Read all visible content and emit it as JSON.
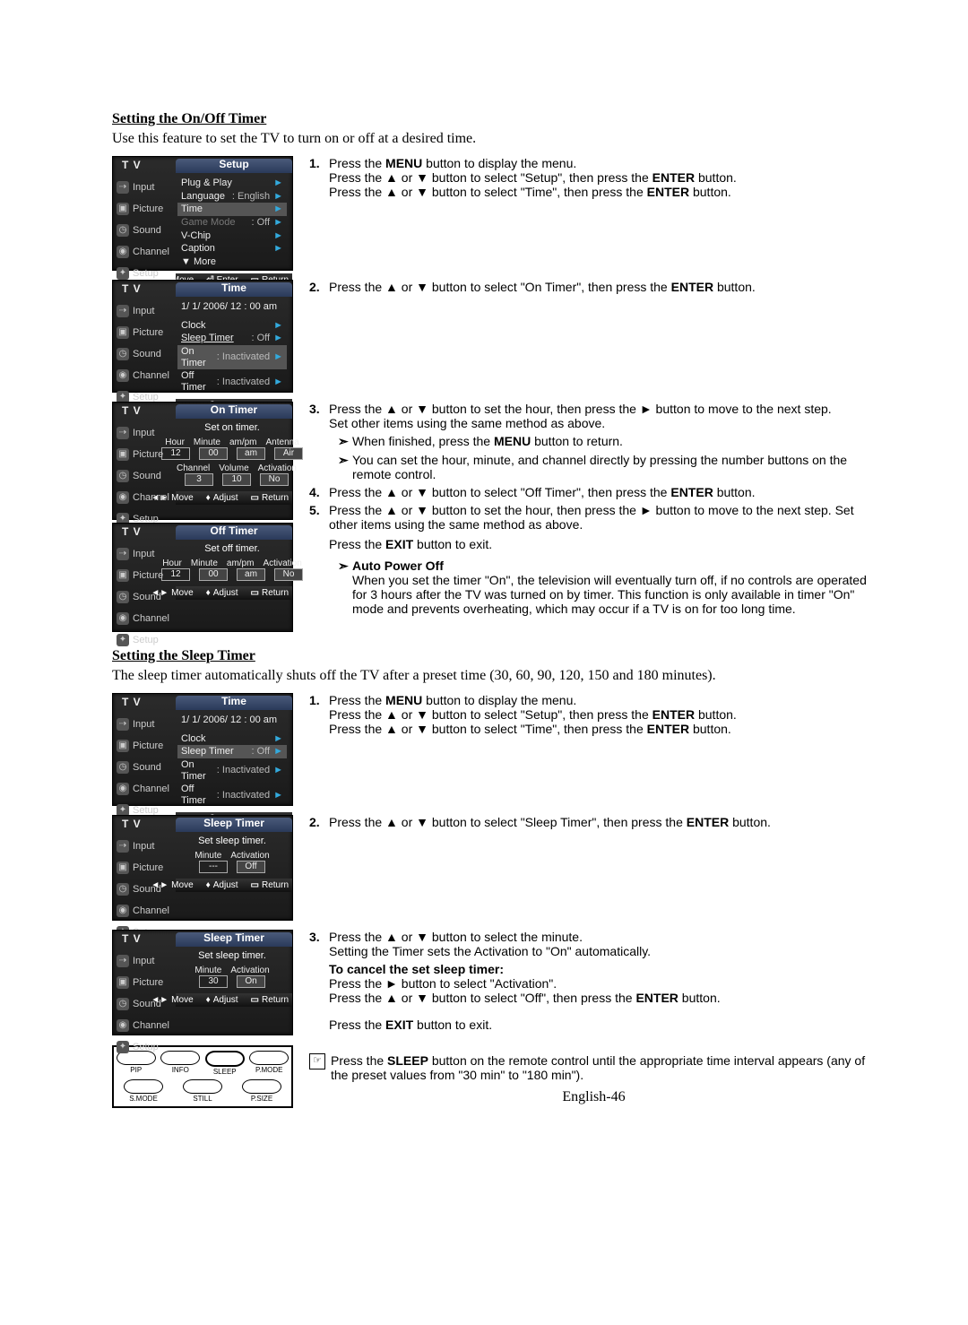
{
  "page": {
    "number": "English-46"
  },
  "section1": {
    "heading": "Setting the On/Off Timer",
    "intro": "Use this feature to set the TV to turn on or off at a desired time.",
    "step1": {
      "l1a": "Press the ",
      "menu": "MENU",
      "l1b": " button to display the menu.",
      "l2a": "Press the ",
      "l2b": " button to select \"Setup\", then press the ",
      "enter": "ENTER",
      "l2c": " button.",
      "l3a": "Press the ",
      "l3b": " button to select \"Time\", then press the ",
      "l3c": " button."
    },
    "step2": {
      "a": "Press the ",
      "b": " button to select \"On Timer\", then press the ",
      "enter": "ENTER",
      "c": " button."
    },
    "step3": {
      "a": "Press the ",
      "b": " button to set the hour, then press the ",
      "c": " button to move to the next step.",
      "d": "Set other items using the same method as above.",
      "sub1a": "When finished, press the ",
      "menu": "MENU",
      "sub1b": " button to return.",
      "sub2": "You can set the hour, minute, and channel directly by pressing the number buttons on the remote control."
    },
    "step4": {
      "a": "Press the ",
      "b": " button to select \"Off Timer\", then press the ",
      "enter": "ENTER",
      "c": " button."
    },
    "step5": {
      "a": "Press the ",
      "b": " button to set the hour, then press the ",
      "c": " button to move to the next step. Set other items using the same method as above.",
      "exit_a": "Press the ",
      "exit": "EXIT",
      "exit_b": " button to exit.",
      "apo_h": "Auto Power Off",
      "apo": "When you set the timer \"On\", the television will eventually turn off, if no controls are operated for 3 hours after the TV was turned on by timer. This function is only available in timer \"On\" mode and prevents overheating, which may occur if a TV is on for too long time."
    }
  },
  "section2": {
    "heading": "Setting the Sleep Timer",
    "intro": "The sleep timer automatically shuts off the TV after a preset time (30, 60, 90, 120, 150 and 180 minutes).",
    "step1": {
      "l1a": "Press the ",
      "menu": "MENU",
      "l1b": " button to display the menu.",
      "l2a": "Press the ",
      "l2b": " button to select \"Setup\", then press the ",
      "enter": "ENTER",
      "l2c": " button.",
      "l3a": "Press the ",
      "l3b": " button to select \"Time\", then press the ",
      "l3c": " button."
    },
    "step2": {
      "a": "Press the ",
      "b": " button to select \"Sleep Timer\", then press the ",
      "enter": "ENTER",
      "c": " button."
    },
    "step3": {
      "a": "Press the ",
      "b": " button to select the minute.",
      "c": "Setting the Timer sets the Activation to \"On\" automatically.",
      "cancel_h": "To cancel the set sleep timer:",
      "cancel_1a": "Press the ",
      "cancel_1b": " button to select \"Activation\".",
      "cancel_2a": "Press the ",
      "cancel_2b": " button to select \"Off\", then press the ",
      "enter": "ENTER",
      "cancel_2c": " button.",
      "exit_a": "Press the ",
      "exit": "EXIT",
      "exit_b": " button to exit."
    },
    "note": {
      "a": "Press the ",
      "sleep": "SLEEP",
      "b": " button on the remote control until the appropriate time interval appears (any of the preset values from \"30 min\" to \"180 min\")."
    }
  },
  "osd_common": {
    "tv": "T V",
    "side": {
      "input": "Input",
      "picture": "Picture",
      "sound": "Sound",
      "channel": "Channel",
      "setup": "Setup"
    },
    "footer": {
      "move": "Move",
      "enter": "Enter",
      "return": "Return",
      "adjust": "Adjust"
    }
  },
  "osd_setup": {
    "title": "Setup",
    "items": {
      "pnp": "Plug & Play",
      "lang": "Language",
      "lang_v": ": English",
      "time": "Time",
      "game": "Game Mode",
      "game_v": ": Off",
      "vchip": "V-Chip",
      "caption": "Caption",
      "more": "▼ More"
    }
  },
  "osd_time1": {
    "title": "Time",
    "date": "1/ 1/ 2006/ 12 : 00  am",
    "clock": "Clock",
    "sleep": "Sleep Timer",
    "sleep_v": ": Off",
    "on": "On Timer",
    "on_v": ": Inactivated",
    "off": "Off Timer",
    "off_v": ": Inactivated"
  },
  "osd_ontimer": {
    "title": "On Timer",
    "prompt": "Set on timer.",
    "h": {
      "hour": "Hour",
      "min": "Minute",
      "ampm": "am/pm",
      "ant": "Antenna",
      "ch": "Channel",
      "vol": "Volume",
      "act": "Activation"
    },
    "v": {
      "hour": "12",
      "min": "00",
      "ampm": "am",
      "ant": "Air",
      "ch": "3",
      "vol": "10",
      "act": "No"
    }
  },
  "osd_offtimer": {
    "title": "Off Timer",
    "prompt": "Set off timer.",
    "h": {
      "hour": "Hour",
      "min": "Minute",
      "ampm": "am/pm",
      "act": "Activation"
    },
    "v": {
      "hour": "12",
      "min": "00",
      "ampm": "am",
      "act": "No"
    }
  },
  "osd_time2": {
    "title": "Time",
    "date": "1/ 1/ 2006/ 12 : 00  am",
    "clock": "Clock",
    "sleep": "Sleep Timer",
    "sleep_v": ": Off",
    "on": "On Timer",
    "on_v": ": Inactivated",
    "off": "Off Timer",
    "off_v": ": Inactivated"
  },
  "osd_sleep1": {
    "title": "Sleep Timer",
    "prompt": "Set sleep timer.",
    "h": {
      "min": "Minute",
      "act": "Activation"
    },
    "v": {
      "min": "---",
      "act": "Off"
    }
  },
  "osd_sleep2": {
    "title": "Sleep Timer",
    "prompt": "Set sleep timer.",
    "h": {
      "min": "Minute",
      "act": "Activation"
    },
    "v": {
      "min": "30",
      "act": "On"
    }
  },
  "remote": {
    "pip": "PIP",
    "info": "INFO",
    "sleep": "SLEEP",
    "pmode": "P.MODE",
    "smode": "S.MODE",
    "still": "STILL",
    "psize": "P.SIZE"
  }
}
